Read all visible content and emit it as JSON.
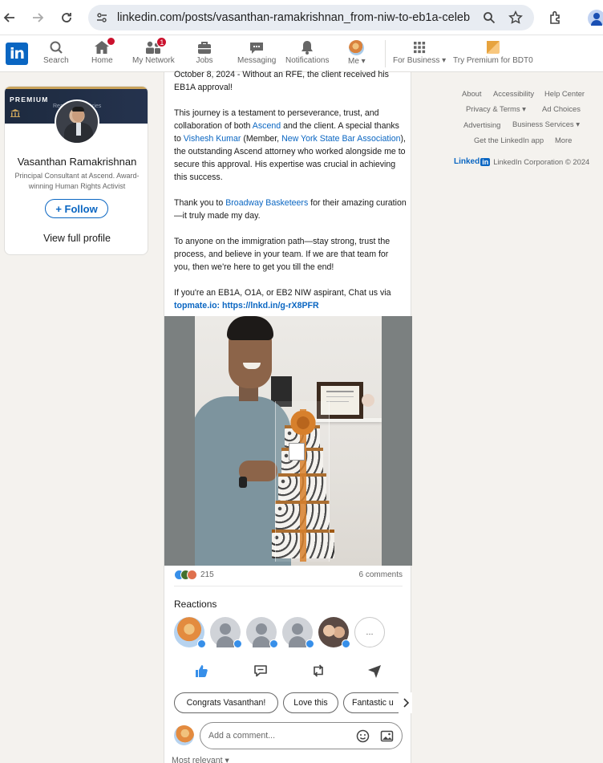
{
  "browser": {
    "url": "linkedin.com/posts/vasanthan-ramakrishnan_from-niw-to-eb1a-celebr..."
  },
  "nav": {
    "badges": {
      "home": "",
      "network": "1"
    },
    "items": [
      {
        "label": "Search"
      },
      {
        "label": "Home"
      },
      {
        "label": "My Network"
      },
      {
        "label": "Jobs"
      },
      {
        "label": "Messaging"
      },
      {
        "label": "Notifications"
      },
      {
        "label": "Me"
      },
      {
        "label": "For Business"
      },
      {
        "label": "Try Premium for BDT0"
      }
    ]
  },
  "profile": {
    "premium_label": "PREMIUM",
    "banner_text": "Read Client Stories",
    "name": "Vasanthan Ramakrishnan",
    "headline": "Principal Consultant at Ascend. Award-winning Human Rights Activist",
    "follow_label": "+ Follow",
    "view_profile_label": "View full profile"
  },
  "post": {
    "p1": "October 8, 2024 - Without an RFE, the client received his EB1A approval!",
    "p2_a": "This journey is a testament to perseverance, trust, and collaboration of both ",
    "p2_ascend": "Ascend",
    "p2_b": " and the client. A special thanks to ",
    "p2_vishesh": "Vishesh Kumar",
    "p2_c": " (Member, ",
    "p2_nysba": "New York State Bar Association",
    "p2_d": "), the outstanding Ascend attorney who worked alongside me to secure this approval. His expertise was crucial in achieving this success.",
    "p3_a": "Thank you to ",
    "p3_broadway": "Broadway Basketeers",
    "p3_b": " for their amazing curation —it truly made my day.",
    "p4": "To anyone on the immigration path—stay strong, trust the process, and believe in your team. If we are that team for you, then we're here to get you till the end!",
    "p5_a": "If you're an EB1A, O1A, or EB2 NIW aspirant, Chat us via ",
    "p5_link": "topmate.io: https://lnkd.in/g-rX8PFR",
    "reaction_count": "215",
    "comments": "6 comments",
    "reactions_title": "Reactions",
    "more_reactors": "...",
    "suggestions": [
      "Congrats Vasanthan!",
      "Love this",
      "Fantastic u"
    ],
    "comment_placeholder": "Add a comment...",
    "sort_label": "Most relevant ▾"
  },
  "footer": {
    "links": [
      "About",
      "Accessibility",
      "Help Center",
      "Privacy & Terms ▾",
      "Ad Choices",
      "Advertising",
      "Business Services ▾",
      "Get the LinkedIn app",
      "More"
    ],
    "brand_word": "Linked",
    "brand_in": "in",
    "copyright": "LinkedIn Corporation © 2024"
  },
  "colors": {
    "brand": "#0a66c2",
    "badge": "#cb112d"
  }
}
